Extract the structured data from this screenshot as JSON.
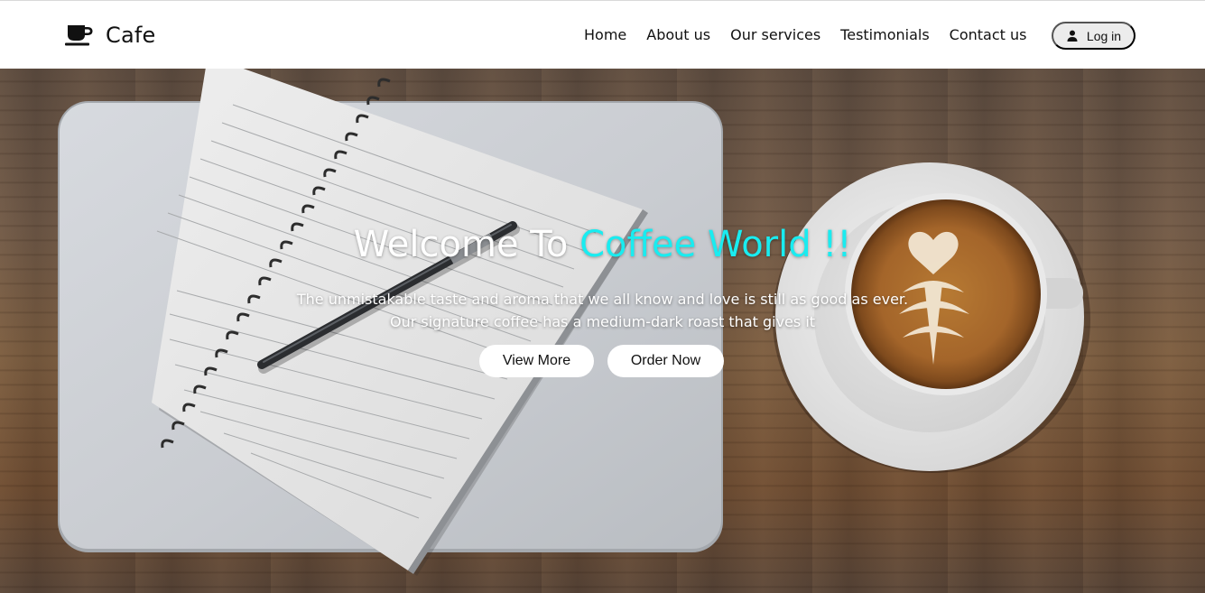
{
  "brand": {
    "name": "Cafe",
    "icon": "coffee-cup-icon"
  },
  "nav": {
    "links": [
      "Home",
      "About us",
      "Our services",
      "Testimonials",
      "Contact us"
    ],
    "login_label": "Log in",
    "login_icon": "user-icon"
  },
  "hero": {
    "title_prefix": "Welcome To ",
    "title_accent": "Coffee World !!",
    "description_line1": "The unmistakable taste and aroma that we all know and love is still as good as ever.",
    "description_line2": "Our signature coffee has a medium-dark roast that gives it",
    "view_more_label": "View More",
    "order_now_label": "Order Now",
    "accent_color": "#19ecf0"
  }
}
